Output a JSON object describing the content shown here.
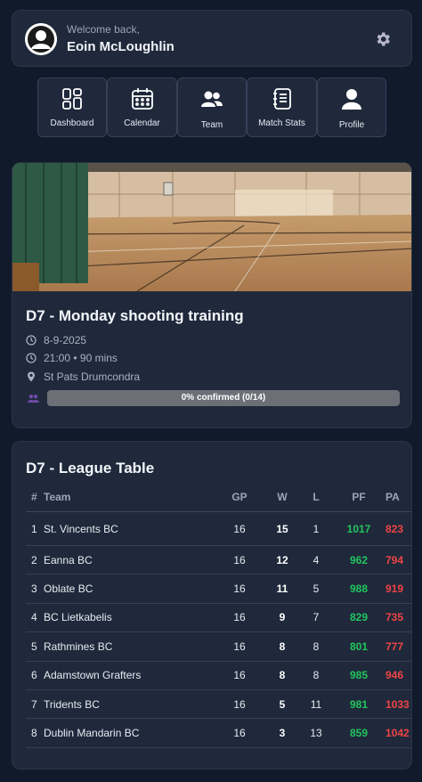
{
  "header": {
    "welcome": "Welcome back,",
    "username": "Eoin McLoughlin"
  },
  "nav": [
    {
      "label": "Dashboard",
      "icon": "dashboard-icon"
    },
    {
      "label": "Calendar",
      "icon": "calendar-icon"
    },
    {
      "label": "Team",
      "icon": "team-icon"
    },
    {
      "label": "Match Stats",
      "icon": "match-stats-icon"
    },
    {
      "label": "Profile",
      "icon": "profile-icon"
    }
  ],
  "event": {
    "title": "D7 - Monday shooting training",
    "date": "8-9-2025",
    "time": "21:00 • 90 mins",
    "location": "St Pats Drumcondra",
    "confirmed_text": "0% confirmed (0/14)",
    "confirmed_fraction": 0
  },
  "league": {
    "title": "D7 - League Table",
    "columns": [
      "#",
      "Team",
      "GP",
      "W",
      "L",
      "PF",
      "PA"
    ],
    "rows": [
      {
        "rank": "1",
        "team": "St. Vincents BC",
        "gp": "16",
        "w": "15",
        "l": "1",
        "pf": "1017",
        "pa": "823"
      },
      {
        "rank": "2",
        "team": "Eanna BC",
        "gp": "16",
        "w": "12",
        "l": "4",
        "pf": "962",
        "pa": "794"
      },
      {
        "rank": "3",
        "team": "Oblate BC",
        "gp": "16",
        "w": "11",
        "l": "5",
        "pf": "988",
        "pa": "919"
      },
      {
        "rank": "4",
        "team": "BC Lietkabelis",
        "gp": "16",
        "w": "9",
        "l": "7",
        "pf": "829",
        "pa": "735"
      },
      {
        "rank": "5",
        "team": "Rathmines BC",
        "gp": "16",
        "w": "8",
        "l": "8",
        "pf": "801",
        "pa": "777"
      },
      {
        "rank": "6",
        "team": "Adamstown Grafters",
        "gp": "16",
        "w": "8",
        "l": "8",
        "pf": "985",
        "pa": "946"
      },
      {
        "rank": "7",
        "team": "Tridents BC",
        "gp": "16",
        "w": "5",
        "l": "11",
        "pf": "981",
        "pa": "1033"
      },
      {
        "rank": "8",
        "team": "Dublin Mandarin BC",
        "gp": "16",
        "w": "3",
        "l": "13",
        "pf": "859",
        "pa": "1042"
      }
    ]
  },
  "colors": {
    "background": "#111a2b",
    "card": "#1f293b",
    "positive": "#22c55e",
    "negative": "#ef4444"
  }
}
